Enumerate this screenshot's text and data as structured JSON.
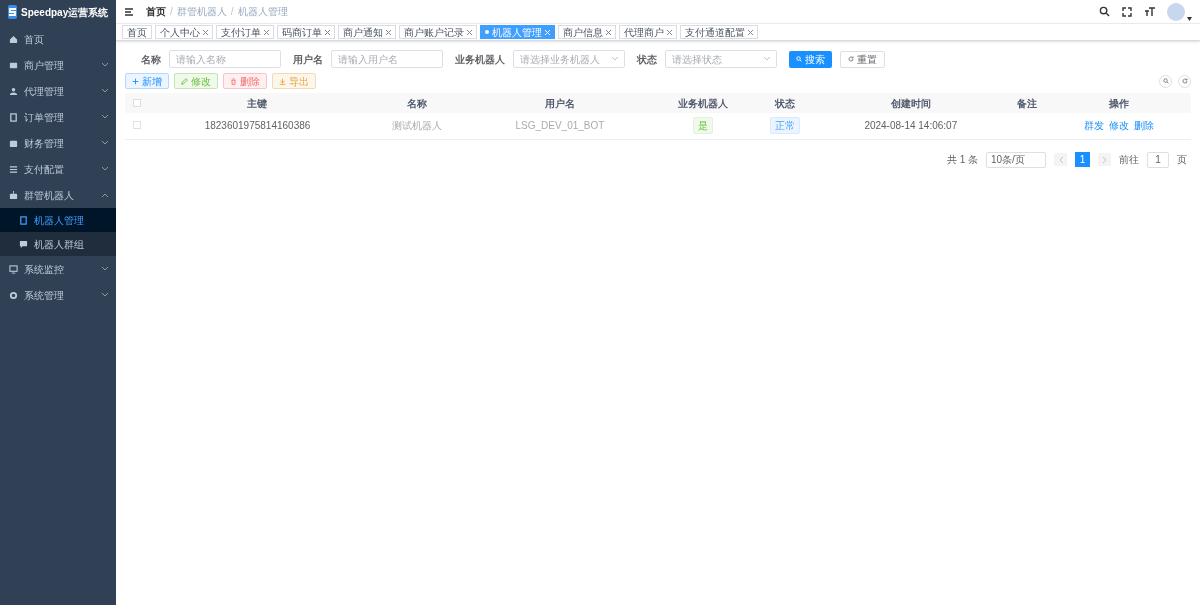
{
  "app": {
    "title": "Speedpay运营系统"
  },
  "sidebar": {
    "items": [
      {
        "label": "首页",
        "kind": "link",
        "selected": false
      },
      {
        "label": "商户管理",
        "kind": "submenu",
        "expanded": false,
        "selected": false
      },
      {
        "label": "代理管理",
        "kind": "submenu",
        "expanded": false,
        "selected": false
      },
      {
        "label": "订单管理",
        "kind": "submenu",
        "expanded": false,
        "selected": false
      },
      {
        "label": "财务管理",
        "kind": "submenu",
        "expanded": false,
        "selected": false
      },
      {
        "label": "支付配置",
        "kind": "submenu",
        "expanded": false,
        "selected": false
      },
      {
        "label": "群管机器人",
        "kind": "submenu",
        "expanded": true,
        "selected": false,
        "children": [
          {
            "label": "机器人管理",
            "selected": true
          },
          {
            "label": "机器人群组",
            "selected": false
          }
        ]
      },
      {
        "label": "系统监控",
        "kind": "submenu",
        "expanded": false,
        "selected": false
      },
      {
        "label": "系统管理",
        "kind": "submenu",
        "expanded": false,
        "selected": false
      }
    ]
  },
  "breadcrumb": {
    "separator": "/",
    "items": [
      "首页",
      "群管机器人",
      "机器人管理"
    ]
  },
  "tabs": [
    {
      "label": "首页",
      "closable": false,
      "selected": false
    },
    {
      "label": "个人中心",
      "closable": true,
      "selected": false
    },
    {
      "label": "支付订单",
      "closable": true,
      "selected": false
    },
    {
      "label": "码商订单",
      "closable": true,
      "selected": false
    },
    {
      "label": "商户通知",
      "closable": true,
      "selected": false
    },
    {
      "label": "商户账户记录",
      "closable": true,
      "selected": false
    },
    {
      "label": "机器人管理",
      "closable": true,
      "selected": true
    },
    {
      "label": "商户信息",
      "closable": true,
      "selected": false
    },
    {
      "label": "代理商户",
      "closable": true,
      "selected": false
    },
    {
      "label": "支付通道配置",
      "closable": true,
      "selected": false
    }
  ],
  "filters": [
    {
      "label": "名称",
      "kind": "input",
      "placeholder": "请输入名称"
    },
    {
      "label": "用户名",
      "kind": "input",
      "placeholder": "请输入用户名"
    },
    {
      "label": "业务机器人",
      "kind": "select",
      "placeholder": "请选择业务机器人"
    },
    {
      "label": "状态",
      "kind": "select",
      "placeholder": "请选择状态"
    }
  ],
  "search_button": "搜索",
  "reset_button": "重置",
  "toolbar": [
    {
      "label": "新增",
      "kind": "primary"
    },
    {
      "label": "修改",
      "kind": "success"
    },
    {
      "label": "删除",
      "kind": "danger"
    },
    {
      "label": "导出",
      "kind": "warning"
    }
  ],
  "table": {
    "select_all_checked": false,
    "columns": [
      "主键",
      "名称",
      "用户名",
      "业务机器人",
      "状态",
      "创建时间",
      "备注",
      "操作"
    ],
    "rows": [
      {
        "checked": false,
        "id": "1823601975814160386",
        "name": "测试机器人",
        "username": "LSG_DEV_01_BOT",
        "business_robot": "是",
        "status": "正常",
        "created": "2024-08-14 14:06:07",
        "actions": [
          "群发",
          "修改",
          "删除"
        ]
      }
    ]
  },
  "pagination": {
    "total": "共 1 条",
    "page_size": "10条/页",
    "pages": [
      {
        "label": "1",
        "selected": true
      }
    ],
    "goto_label": "前往",
    "goto_value": "1",
    "goto_suffix": "页"
  }
}
